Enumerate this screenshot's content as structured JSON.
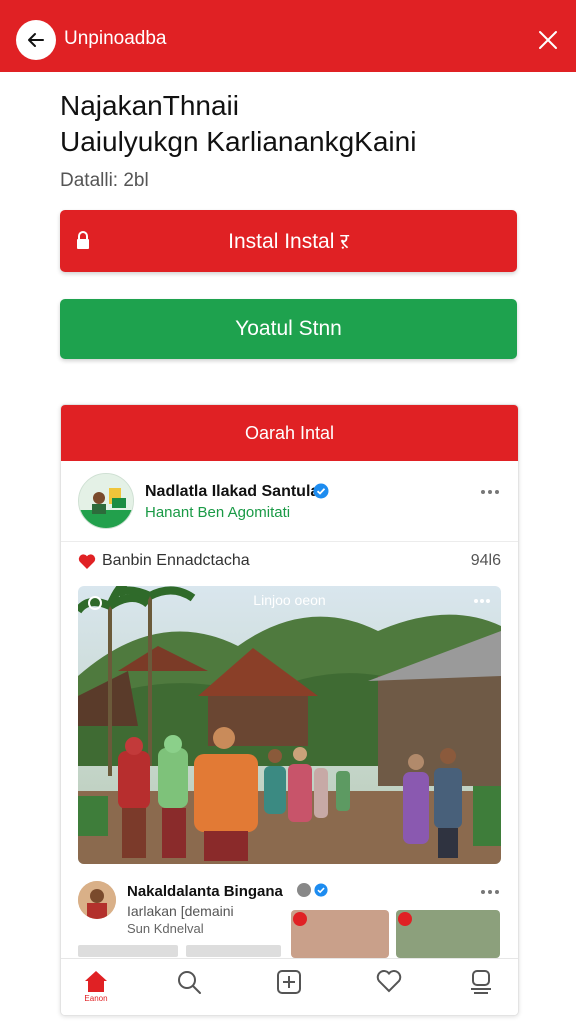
{
  "header": {
    "title": "Unpinoadba"
  },
  "page": {
    "title_line1": "NajakanThnaii",
    "title_line2": "Uaiulyukgn KarlianankgKaini",
    "subtitle": "Datalli: 2bl"
  },
  "buttons": {
    "install_label": "Instal Instal ऱ",
    "green_label": "Yoatul Stnn"
  },
  "card": {
    "header_label": "Oarah Intal",
    "post": {
      "name": "Nadlatla Ilakad Santula",
      "subtitle": "Hanant  Ben Agomitati",
      "likes_text": "Banbin Ennadctacha",
      "likes_count": "94l6",
      "photo_caption": "Linjoo oeon"
    },
    "post2": {
      "name": "Nakaldalanta Bingana",
      "line1": "Iarlakan [demaini",
      "line2": "Sun  Kdnelval"
    }
  },
  "nav": {
    "home_label": "Eanon"
  },
  "colors": {
    "brand_red": "#e02124",
    "accent_green": "#1ea24e",
    "verified_blue": "#1d8cf0"
  }
}
